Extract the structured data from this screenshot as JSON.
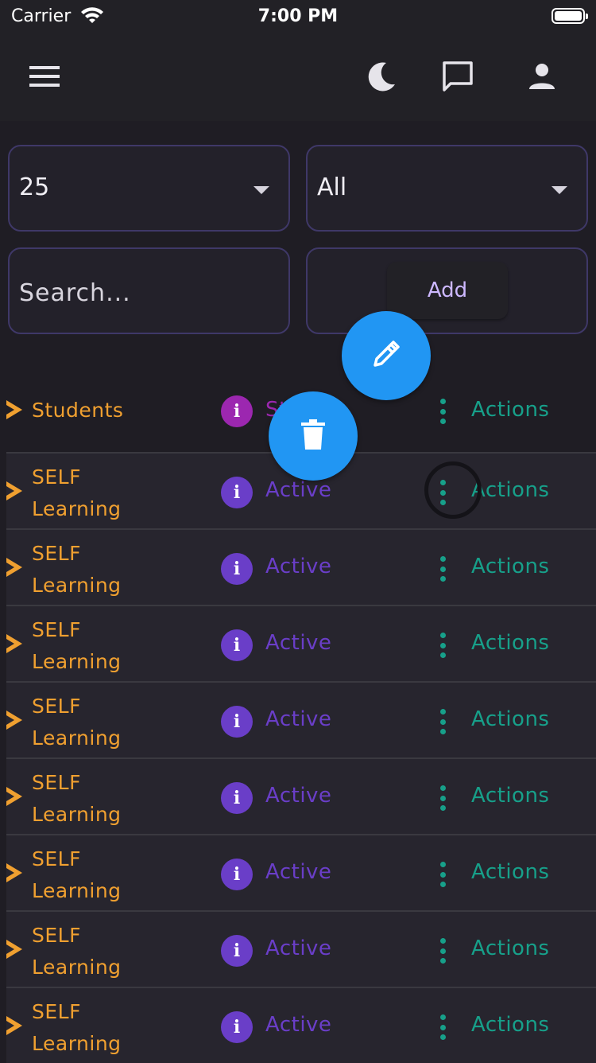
{
  "status_bar": {
    "carrier": "Carrier",
    "time": "7:00 PM"
  },
  "app_bar": {
    "icons": [
      "menu-icon",
      "moon-icon",
      "chat-icon",
      "person-icon"
    ]
  },
  "filters": {
    "page_size": "25",
    "status_filter": "All",
    "search_placeholder": "Search...",
    "add_label": "Add"
  },
  "table": {
    "header": {
      "students": "Students",
      "status": "St",
      "actions": "Actions"
    },
    "rows": [
      {
        "line1": "SELF",
        "line2": "Learning",
        "status": "Active",
        "actions": "Actions"
      },
      {
        "line1": "SELF",
        "line2": "Learning",
        "status": "Active",
        "actions": "Actions"
      },
      {
        "line1": "SELF",
        "line2": "Learning",
        "status": "Active",
        "actions": "Actions"
      },
      {
        "line1": "SELF",
        "line2": "Learning",
        "status": "Active",
        "actions": "Actions"
      },
      {
        "line1": "SELF",
        "line2": "Learning",
        "status": "Active",
        "actions": "Actions"
      },
      {
        "line1": "SELF",
        "line2": "Learning",
        "status": "Active",
        "actions": "Actions"
      },
      {
        "line1": "SELF",
        "line2": "Learning",
        "status": "Active",
        "actions": "Actions"
      },
      {
        "line1": "SELF",
        "line2": "Learning",
        "status": "Active",
        "actions": "Actions"
      }
    ]
  },
  "fabs": {
    "edit_icon": "pencil-icon",
    "delete_icon": "trash-icon"
  },
  "colors": {
    "accent_orange": "#f0a030",
    "status_purple": "#6a3ec8",
    "header_info_purple": "#9c27b0",
    "actions_teal": "#17a08a",
    "fab_blue": "#2196f3"
  }
}
